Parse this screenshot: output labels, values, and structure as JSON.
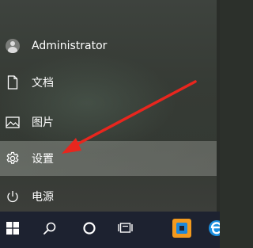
{
  "start_menu": {
    "user": {
      "name": "Administrator",
      "icon": "user-avatar-icon"
    },
    "items": [
      {
        "label": "文档",
        "icon": "document-icon"
      },
      {
        "label": "图片",
        "icon": "picture-icon"
      },
      {
        "label": "设置",
        "icon": "gear-icon",
        "highlighted": true
      },
      {
        "label": "电源",
        "icon": "power-icon"
      }
    ]
  },
  "annotation": {
    "type": "arrow",
    "color": "#e8261e",
    "points_to": "设置"
  },
  "taskbar": {
    "background": "#1d2230",
    "buttons": [
      {
        "icon": "windows-start-icon"
      },
      {
        "icon": "search-icon"
      },
      {
        "icon": "cortana-circle-icon"
      },
      {
        "icon": "task-view-icon"
      },
      {
        "icon": "app-icon-orange-blue"
      },
      {
        "icon": "edge-browser-icon"
      }
    ]
  }
}
